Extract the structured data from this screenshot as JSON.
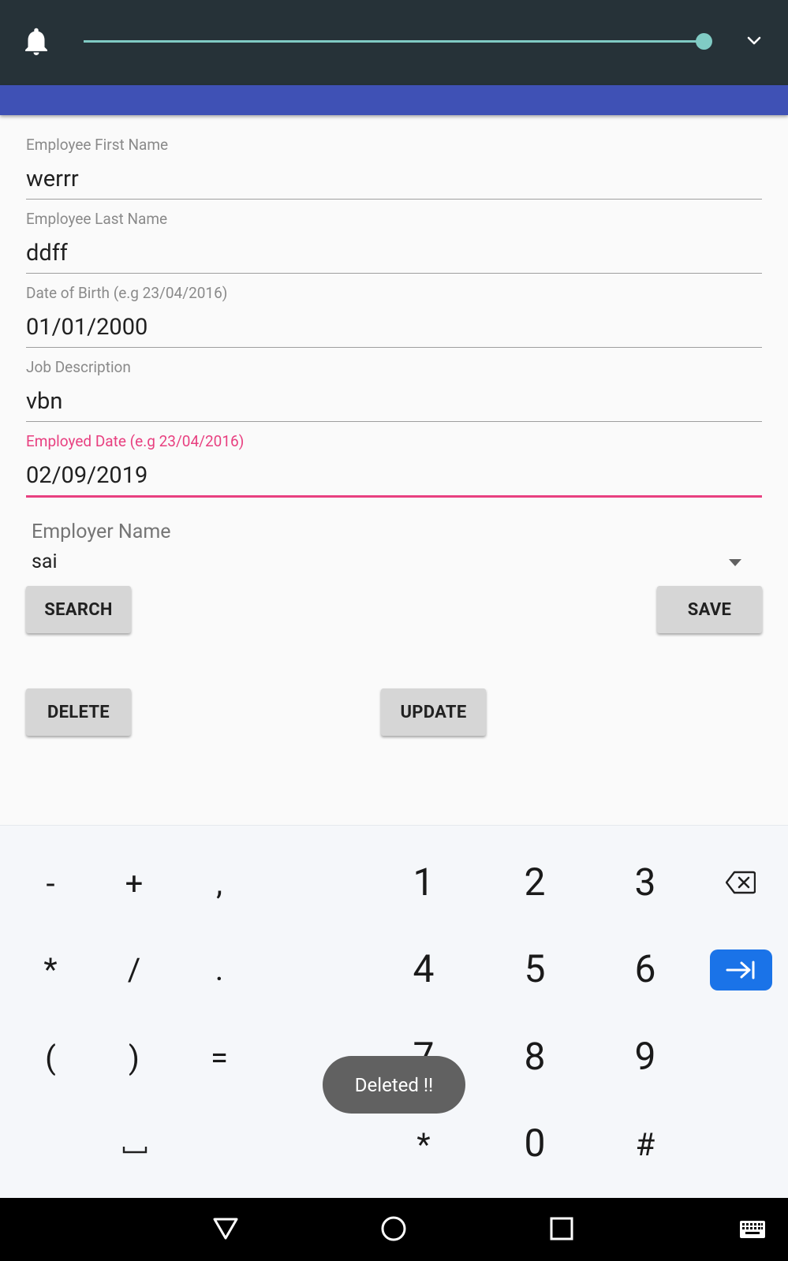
{
  "form": {
    "first_name_label": "Employee First Name",
    "first_name_value": "werrr",
    "last_name_label": "Employee Last Name",
    "last_name_value": "ddff",
    "dob_label": "Date of Birth (e.g 23/04/2016)",
    "dob_value": "01/01/2000",
    "job_label": "Job Description",
    "job_value": "vbn",
    "employed_label": "Employed Date (e.g 23/04/2016)",
    "employed_value": "02/09/2019",
    "employer_label": "Employer Name",
    "employer_value": "sai"
  },
  "buttons": {
    "search": "SEARCH",
    "save": "SAVE",
    "delete": "DELETE",
    "update": "UPDATE"
  },
  "keyboard": {
    "row1": [
      "-",
      "+",
      ",",
      "1",
      "2",
      "3"
    ],
    "row2": [
      "*",
      "/",
      ".",
      "4",
      "5",
      "6"
    ],
    "row3": [
      "(",
      ")",
      "=",
      "7",
      "8",
      "9"
    ],
    "row4": [
      "*",
      "0",
      "#"
    ],
    "icons": [
      "backspace-icon",
      "tab-enter-icon",
      "space-icon"
    ]
  },
  "toast": "Deleted !!",
  "colors": {
    "status_bar": "#263238",
    "app_bar": "#3f51b5",
    "accent": "#e84080",
    "slider": "#80cbc4",
    "enter_key": "#1a73e8"
  },
  "status_icons": [
    "bell-icon",
    "chevron-down-icon"
  ],
  "nav_icons": [
    "back-icon",
    "home-icon",
    "recents-icon",
    "keyboard-icon"
  ],
  "brightness_level": 0.98
}
